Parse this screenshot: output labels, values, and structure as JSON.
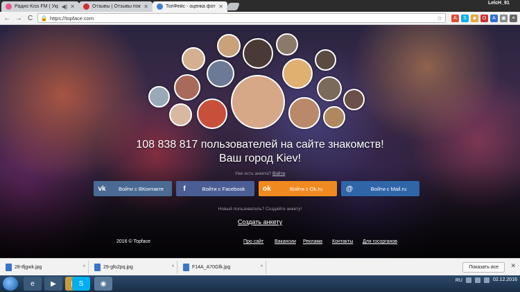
{
  "tabs": [
    {
      "label": "Радио Kiss FM ( Укра",
      "icon_color": "#e85a8a",
      "close": "✕",
      "audio": "◀)"
    },
    {
      "label": "Отзывы | Отзывы покупа",
      "icon_color": "#d0312d",
      "close": "✕"
    },
    {
      "label": "ТопФейс - оценка фото",
      "icon_color": "#3b7fd6",
      "close": "✕",
      "active": true
    }
  ],
  "window": {
    "user": "LelcH_91",
    "minimize": "—",
    "maximize": "▭",
    "close": "✕"
  },
  "toolbar": {
    "back": "←",
    "forward": "→",
    "reload": "C",
    "url": "https://topface.com"
  },
  "hero": {
    "headline_line1": "108 838 817 пользователей на сайте знакомств!",
    "headline_line2": "Ваш город Kiev!",
    "have_profile_prefix": "Уже есть анкета?",
    "have_profile_link": "Войти"
  },
  "login": [
    {
      "icon": "vk",
      "label": "Войти с ВКонтакте"
    },
    {
      "icon": "f",
      "label": "Войти с Facebook"
    },
    {
      "icon": "ok",
      "label": "Войти с Ok.ru"
    },
    {
      "icon": "@",
      "label": "Войти с Mail.ru"
    }
  ],
  "new_user_text": "Новый пользователь? Создайте анкету!",
  "create_profile": "Создать анкету",
  "footer": {
    "copyright": "2016 © Topface",
    "links": [
      "Про сайт",
      "Вакансии",
      "Реклама",
      "Контакты",
      "Для госорганов"
    ]
  },
  "downloads": [
    {
      "name": "28-tfjgwk.jpg"
    },
    {
      "name": "29-gfo2pq.jpg"
    },
    {
      "name": "F14A_A70Gfk.jpg"
    }
  ],
  "download_bar": {
    "show_all": "Показать все",
    "close": "✕"
  },
  "taskbar": {
    "lang": "RU",
    "time": "11:??",
    "date": "02.12.2016"
  },
  "avatar_colors": [
    "#c9a27a",
    "#d86b4d",
    "#8a6a5a",
    "#a88070",
    "#6d5a4a",
    "#b08a7a",
    "#e0b090",
    "#7a8aa0",
    "#c07060",
    "#9a7a6a",
    "#d4a070",
    "#5a4a40",
    "#b07050",
    "#c89880",
    "#e0b898",
    "#8a6050",
    "#a09080"
  ]
}
